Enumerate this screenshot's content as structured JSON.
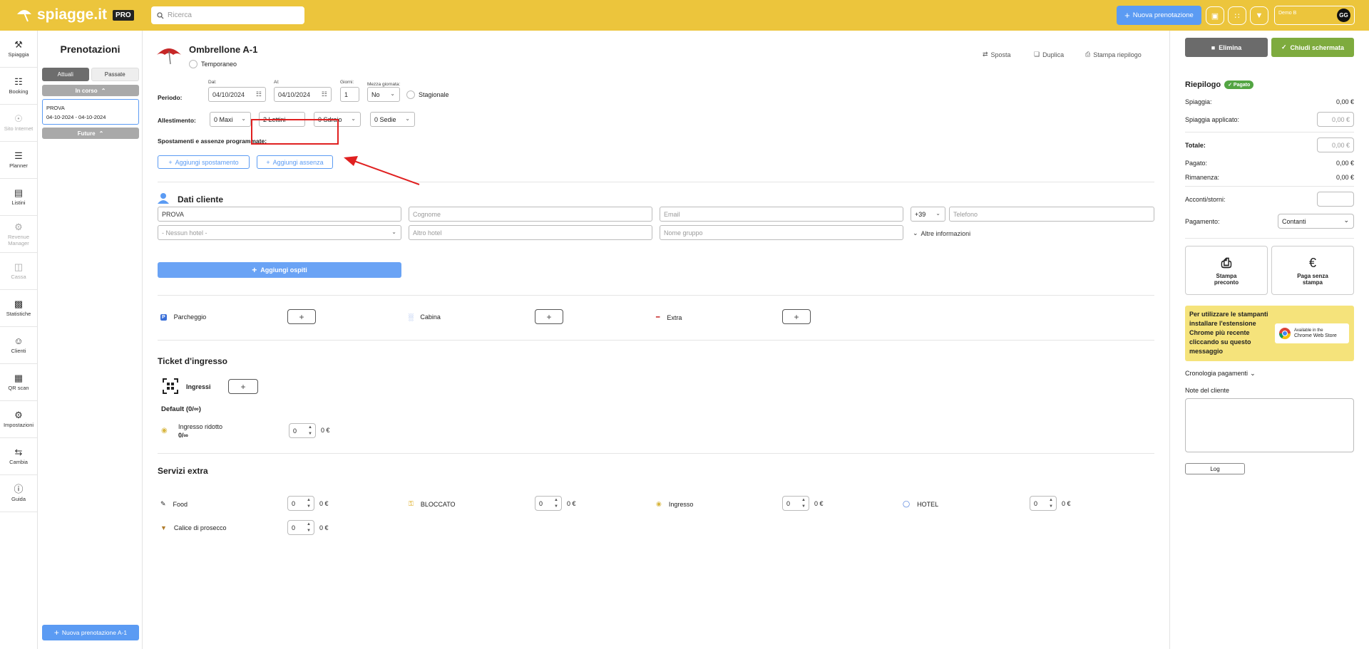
{
  "topbar": {
    "logo_text": "spiagge.it",
    "logo_badge": "PRO",
    "search_placeholder": "Ricerca",
    "new_booking": "Nuova prenotazione",
    "user_name": "Demo B",
    "avatar": "GG"
  },
  "sidebar": [
    {
      "label": "Spiaggia",
      "icon": "beach-icon",
      "disabled": false
    },
    {
      "label": "Booking",
      "icon": "calendar-icon",
      "disabled": false
    },
    {
      "label": "Sito Internet",
      "icon": "globe-icon",
      "disabled": true
    },
    {
      "label": "Planner",
      "icon": "planner-icon",
      "disabled": false
    },
    {
      "label": "Listini",
      "icon": "list-icon",
      "disabled": false
    },
    {
      "label": "Revenue Manager",
      "icon": "revenue-icon",
      "disabled": true
    },
    {
      "label": "Cassa",
      "icon": "register-icon",
      "disabled": true
    },
    {
      "label": "Statistiche",
      "icon": "chart-icon",
      "disabled": false
    },
    {
      "label": "Clienti",
      "icon": "user-icon",
      "disabled": false
    },
    {
      "label": "QR scan",
      "icon": "qr-icon",
      "disabled": false
    },
    {
      "label": "Impostazioni",
      "icon": "gear-icon",
      "disabled": false
    },
    {
      "label": "Cambia",
      "icon": "swap-icon",
      "disabled": false
    },
    {
      "label": "Guida",
      "icon": "help-icon",
      "disabled": false
    }
  ],
  "left": {
    "title": "Prenotazioni",
    "tab_current": "Attuali",
    "tab_past": "Passate",
    "in_progress": "In corso",
    "future": "Future",
    "booking_name": "PROVA",
    "booking_dates": "04-10-2024 - 04-10-2024",
    "new_booking_unit": "Nuova prenotazione A-1"
  },
  "main": {
    "unit": "Ombrellone A-1",
    "temporary": "Temporaneo",
    "move": "Sposta",
    "duplicate": "Duplica",
    "print_summary": "Stampa riepilogo",
    "period_label": "Periodo:",
    "from_label": "Dal:",
    "from": "04/10/2024",
    "to_label": "Al:",
    "to": "04/10/2024",
    "days_label": "Giorni:",
    "days": "1",
    "half_day_label": "Mezza giornata:",
    "half_day": "No",
    "seasonal": "Stagionale",
    "setup_label": "Allestimento:",
    "setup": [
      "0 Maxi",
      "2 Lettini",
      "0 Sdraio",
      "0 Sedie"
    ],
    "moves_label": "Spostamenti e assenze programmate:",
    "add_move": "Aggiungi spostamento",
    "add_absence": "Aggiungi assenza",
    "customer_title": "Dati cliente",
    "first_name": "PROVA",
    "last_name_ph": "Cognome",
    "email_ph": "Email",
    "phone_prefix": "+39",
    "phone_ph": "Telefono",
    "hotel_ph": "- Nessun hotel -",
    "other_hotel_ph": "Altro hotel",
    "group_ph": "Nome gruppo",
    "more_info": "Altre informazioni",
    "add_guests": "Aggiungi ospiti",
    "addons": [
      {
        "label": "Parcheggio",
        "icon": "parking-icon"
      },
      {
        "label": "Cabina",
        "icon": "cabin-icon"
      },
      {
        "label": "Extra",
        "icon": "extra-icon"
      }
    ],
    "ticket_title": "Ticket d'ingresso",
    "entries": "Ingressi",
    "default_group": "Default (0/∞)",
    "reduced_entry": "Ingresso ridotto",
    "reduced_count": "0/∞",
    "reduced_qty": "0",
    "reduced_price": "0 €",
    "services_title": "Servizi extra",
    "services": [
      {
        "label": "Food",
        "icon": "food-icon",
        "qty": "0",
        "price": "0 €"
      },
      {
        "label": "BLOCCATO",
        "icon": "lock-icon",
        "qty": "0",
        "price": "0 €"
      },
      {
        "label": "Ingresso",
        "icon": "ticket-icon",
        "qty": "0",
        "price": "0 €"
      },
      {
        "label": "HOTEL",
        "icon": "hotel-icon",
        "qty": "0",
        "price": "0 €"
      },
      {
        "label": "Calice di prosecco",
        "icon": "drink-icon",
        "qty": "0",
        "price": "0 €"
      }
    ]
  },
  "right": {
    "delete": "Elimina",
    "close": "Chiudi schermata",
    "summary_title": "Riepilogo",
    "paid_badge": "Pagato",
    "beach": "Spiaggia:",
    "beach_value": "0,00 €",
    "beach_applied": "Spiaggia applicato:",
    "beach_applied_ph": "0,00 €",
    "total": "Totale:",
    "total_ph": "0,00 €",
    "paid": "Pagato:",
    "paid_value": "0,00 €",
    "remaining": "Rimanenza:",
    "remaining_value": "0,00 €",
    "deposits": "Acconti/storni:",
    "payment": "Pagamento:",
    "payment_value": "Contanti",
    "print_pre": "Stampa preconto",
    "pay_no_print": "Paga senza stampa",
    "printer_note": "Per utilizzare le stampanti installare l'estensione Chrome più recente cliccando su questo messaggio",
    "chrome_store_1": "Available in the",
    "chrome_store_2": "Chrome Web Store",
    "payment_history": "Cronologia pagamenti",
    "customer_notes": "Note del cliente",
    "log": "Log"
  },
  "colors": {
    "topbar": "#ecc53c",
    "primary": "#5b9bf3",
    "success": "#7eab3e",
    "danger": "#e02020"
  }
}
